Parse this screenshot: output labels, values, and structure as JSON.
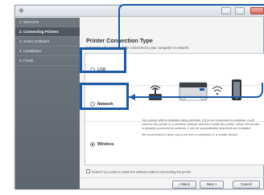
{
  "window": {
    "app_icon": "✥",
    "controls": [
      "minimize",
      "maximize",
      "close"
    ]
  },
  "sidebar": {
    "steps": [
      {
        "label": "1. Welcome",
        "active": false
      },
      {
        "label": "2. Connecting Printers",
        "active": true
      },
      {
        "label": "3. Select Software",
        "active": false
      },
      {
        "label": "4. Installation",
        "active": false
      },
      {
        "label": "5. Finish",
        "active": false
      }
    ]
  },
  "main": {
    "title": "Printer Connection Type",
    "subtitle": "Select how the printer will be connected to your computer or network."
  },
  "options": {
    "usb": {
      "label": "USB",
      "selected": false
    },
    "network": {
      "label": "Network",
      "selected": false
    },
    "wireless": {
      "label": "Wireless",
      "selected": true
    }
  },
  "devices": [
    "router-icon",
    "printer-icon",
    "mobile-device-icon"
  ],
  "description": {
    "para1": "Your printer will be installed using wireless. If it is not connected to wireless, it will connect the printer to a wireless network and then install the printer. When the printer is already connected to wireless, it will be automatically searched and installed.",
    "para2": "We recommend it when you print from a computer or a mobile device."
  },
  "skip_option": {
    "label": "Select if you want to install the software without connecting the printer.",
    "checked": false
  },
  "buttons": {
    "back": "< Back",
    "next": "Next >",
    "cancel": "Cancel"
  },
  "colors": {
    "callout": "#1c5aa6",
    "sidebar": "#666e77",
    "accent": "#1f2a33"
  }
}
